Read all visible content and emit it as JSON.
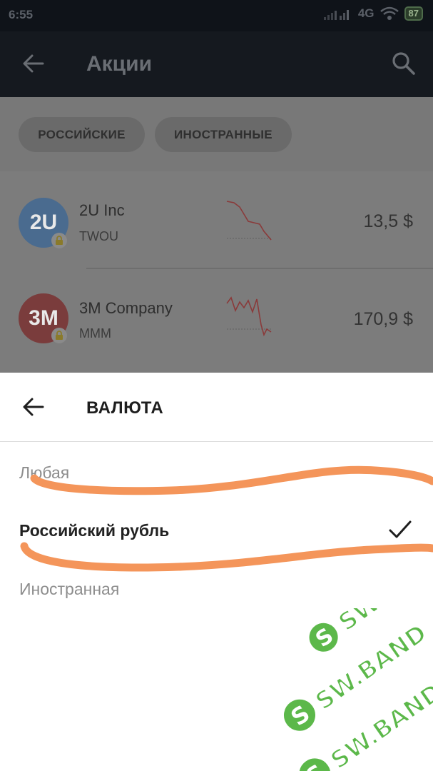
{
  "status_bar": {
    "time": "6:55",
    "network": "4G",
    "battery": "87"
  },
  "app_bar": {
    "title": "Акции"
  },
  "filters": [
    {
      "label": "РОССИЙСКИЕ"
    },
    {
      "label": "ИНОСТРАННЫЕ"
    }
  ],
  "stocks": [
    {
      "logo_text": "2U",
      "name": "2U Inc",
      "ticker": "TWOU",
      "price": "13,5 $",
      "logo_color": "#4a6b8f"
    },
    {
      "logo_text": "3M",
      "name": "3M Company",
      "ticker": "MMM",
      "price": "170,9 $",
      "logo_color": "#7a3c3c"
    }
  ],
  "sheet": {
    "title": "ВАЛЮТА",
    "options": [
      {
        "label": "Любая",
        "selected": false
      },
      {
        "label": "Российский рубль",
        "selected": true
      },
      {
        "label": "Иностранная",
        "selected": false
      }
    ]
  },
  "watermark": {
    "text": "SW.BAND",
    "color": "#5cb84a"
  },
  "colors": {
    "scribble": "#f4955a",
    "sparkline": "#8a3a3a"
  }
}
